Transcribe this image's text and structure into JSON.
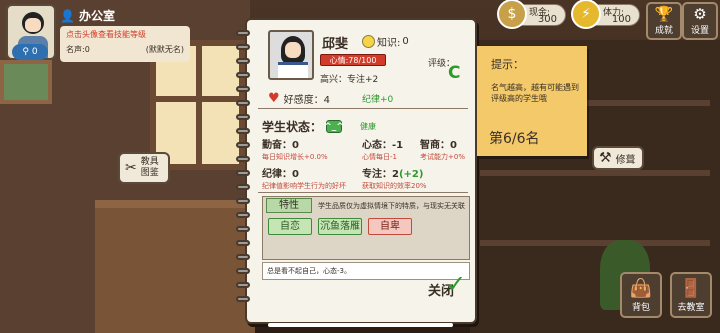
{
  "header": {
    "office": "办公室",
    "avatar_level": "0",
    "tip": "点击头像查看技能等级",
    "reputation": "名声:0",
    "title": "(默默无名)"
  },
  "resources": {
    "cash_label": "现金:",
    "cash": "300",
    "stamina_label": "体力:",
    "stamina": "100"
  },
  "top_buttons": {
    "achievements": "成就",
    "settings": "设置"
  },
  "tools": {
    "textbook": "教具\n图鉴",
    "repair": "修葺"
  },
  "student": {
    "name": "邱斐",
    "knowledge_label": "知识:",
    "knowledge": "0",
    "mood": "心情:78/100",
    "happy": "高兴：专注+2",
    "rating_label": "评级：",
    "rating": "C",
    "affinity": "好感度：4",
    "discipline_effect": "纪律+0",
    "state_label": "学生状态：",
    "state_icon_text": "^_^",
    "health": "健康",
    "stats": {
      "diligence": "勤奋：0",
      "mentality": "心态：-1",
      "iq": "智商：0",
      "discipline": "纪律：0",
      "focus": "专注：2",
      "focus_bonus": "(+2)"
    },
    "subs": {
      "diligence": "每日知识增长+0.0%",
      "mentality": "心情每日-1",
      "iq": "考试能力+0%",
      "discipline": "纪律值影响学生行为的好坏",
      "focus": "获取知识的效率20%"
    }
  },
  "traits": {
    "tab": "特性",
    "note": "学生品质仅为虚拟情境下的特质，与现实无关联",
    "items": [
      {
        "label": "自恋",
        "kind": "good"
      },
      {
        "label": "沉鱼落雁",
        "kind": "good"
      },
      {
        "label": "自卑",
        "kind": "bad"
      }
    ],
    "desc": "总是看不起自己，心态-3。"
  },
  "close": "关闭",
  "sticky": {
    "title": "提示：",
    "desc": "名气越高，越有可能遇到评级高的学生哦",
    "rank": "第6/6名"
  },
  "bottom": {
    "bag": "背包",
    "classroom": "去教室"
  },
  "colors": {
    "green": "#2d9a2a",
    "red": "#d23b2a",
    "note": "#f3c96a"
  }
}
